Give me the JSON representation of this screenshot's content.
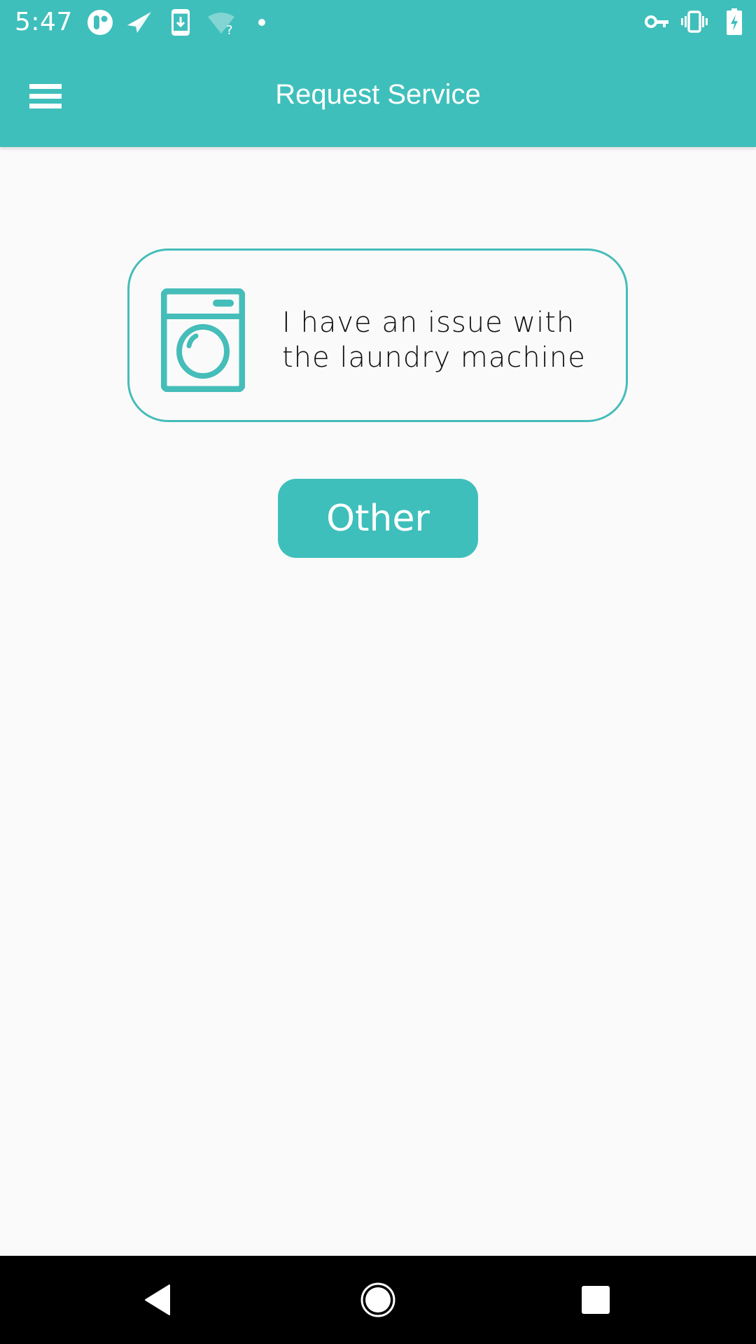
{
  "status_bar": {
    "time": "5:47",
    "left_icons": [
      "app-logo-icon",
      "send-icon",
      "download-icon",
      "wifi-unknown-icon",
      "notification-dot-icon"
    ],
    "right_icons": [
      "vpn-key-icon",
      "vibrate-icon",
      "battery-charging-icon"
    ]
  },
  "app_bar": {
    "title": "Request Service",
    "menu_icon": "hamburger-menu-icon"
  },
  "main": {
    "options": [
      {
        "icon": "washing-machine-icon",
        "label": "I have an issue with the laundry machine"
      }
    ],
    "other_button": "Other"
  },
  "nav_bar": {
    "buttons": [
      "back",
      "home",
      "recents"
    ]
  },
  "colors": {
    "accent": "#3fbfbb",
    "background": "#fafafa",
    "text": "#111111"
  }
}
